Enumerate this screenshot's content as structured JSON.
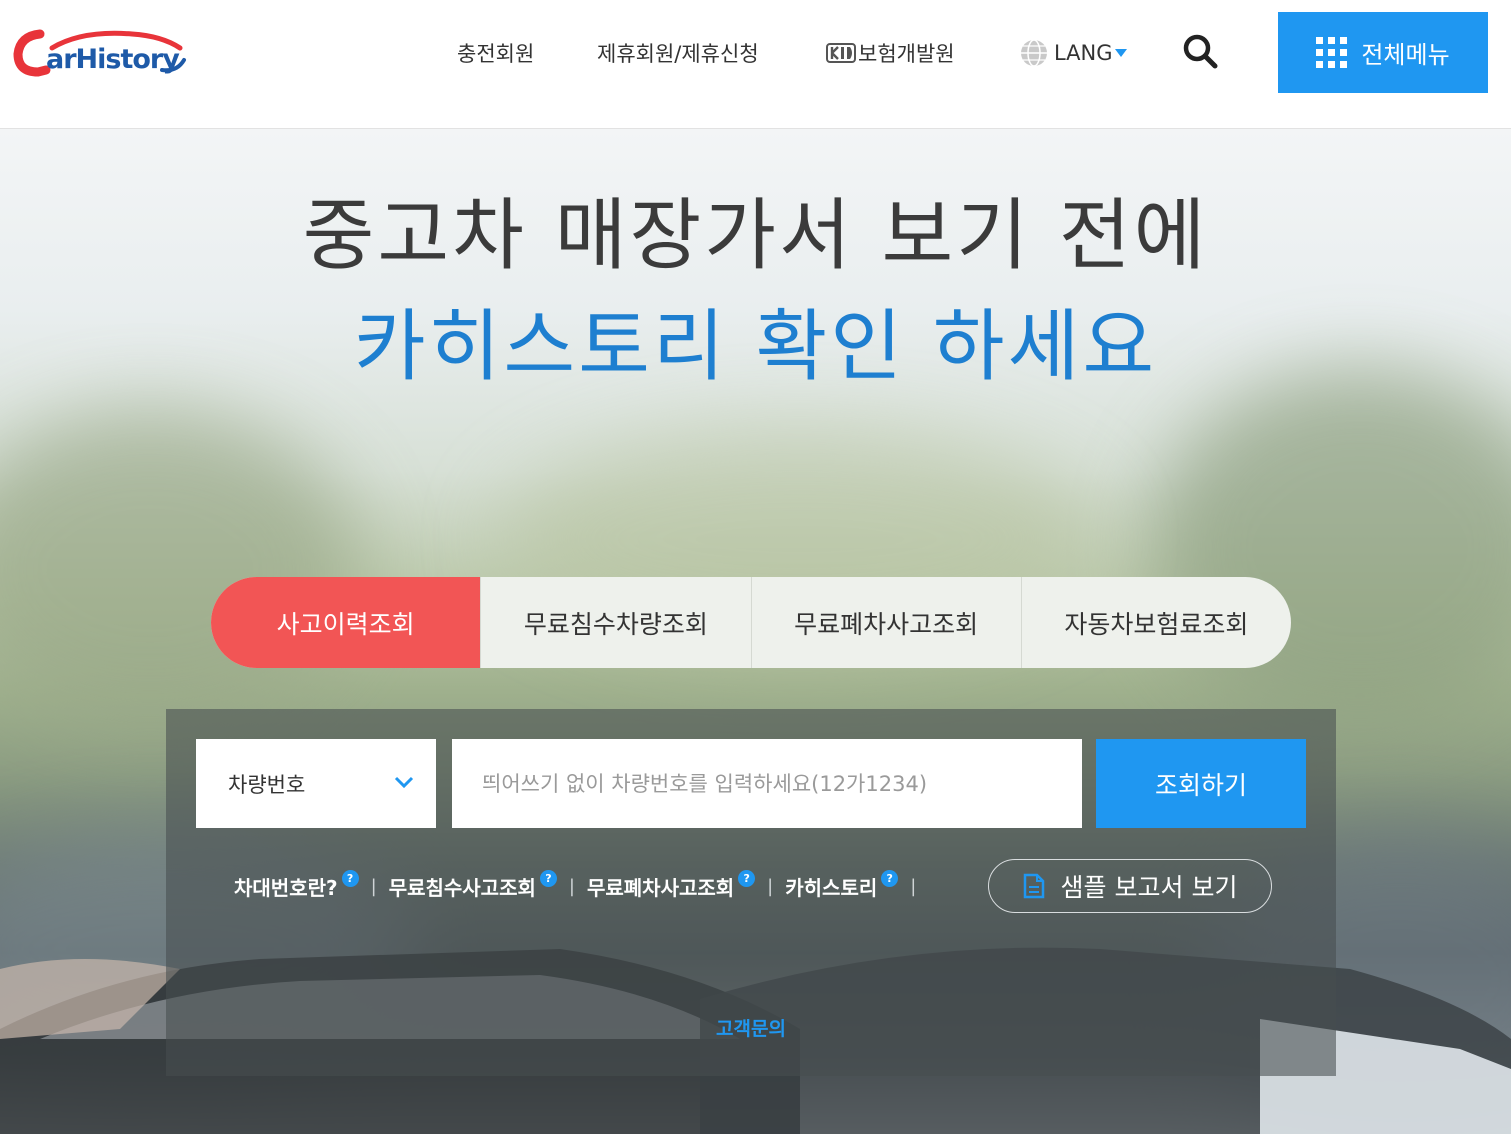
{
  "header": {
    "logo_text": "CarHistory",
    "nav": [
      {
        "label": "충전회원"
      },
      {
        "label": "제휴회원/제휴신청"
      },
      {
        "label": "보험개발원"
      },
      {
        "label": "LANG"
      }
    ],
    "all_menu_label": "전체메뉴"
  },
  "hero": {
    "line1": "중고차 매장가서 보기 전에",
    "line2": "카히스토리 확인 하세요"
  },
  "tabs": [
    {
      "label": "사고이력조회",
      "active": true
    },
    {
      "label": "무료침수차량조회",
      "active": false
    },
    {
      "label": "무료폐차사고조회",
      "active": false
    },
    {
      "label": "자동차보험료조회",
      "active": false
    }
  ],
  "search": {
    "select_value": "차량번호",
    "input_value": "",
    "input_placeholder": "띄어쓰기 없이 차량번호를 입력하세요(12가1234)",
    "submit_label": "조회하기"
  },
  "help_links": [
    {
      "label": "차대번호란?"
    },
    {
      "label": "무료침수사고조회"
    },
    {
      "label": "무료폐차사고조회"
    },
    {
      "label": "카히스토리"
    }
  ],
  "help_icon_glyph": "?",
  "sample_report_label": "샘플 보고서 보기",
  "customer_inquiry_label": "고객문의",
  "colors": {
    "accent_blue": "#1f97f1",
    "active_tab_red": "#f25555",
    "headline_blue": "#1e7fd0",
    "headline_dark": "#3b3b3b"
  },
  "icons": [
    "carhistory-logo",
    "kidi-icon",
    "globe-icon",
    "caret-down-icon",
    "search-icon",
    "grid-menu-icon",
    "chevron-down-icon",
    "question-icon",
    "document-icon"
  ]
}
